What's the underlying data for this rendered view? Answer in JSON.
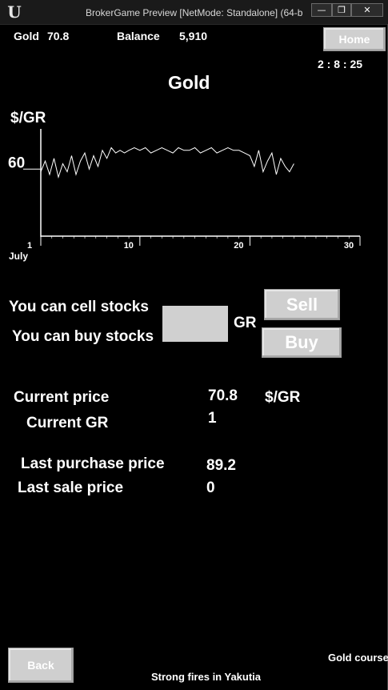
{
  "window": {
    "title": "BrokerGame Preview [NetMode: Standalone]  (64-b",
    "logo": "U",
    "minimize": "—",
    "maximize": "❐",
    "close": "✕"
  },
  "header": {
    "commodity_label": "Gold",
    "commodity_value": "70.8",
    "balance_label": "Balance",
    "balance_value": "5,910",
    "home_button": "Home",
    "timer": "2 : 8 : 25"
  },
  "chart_title": "Gold",
  "chart_data": {
    "type": "line",
    "title": "Gold",
    "ylabel": "$/GR",
    "xlabel": "July",
    "y_tick_labels": [
      "60"
    ],
    "y_tick_values": [
      60
    ],
    "x_tick_labels": [
      "1",
      "10",
      "20",
      "30"
    ],
    "x_tick_values": [
      1,
      10,
      20,
      30
    ],
    "xlim": [
      1,
      30
    ],
    "ylim": [
      35,
      75
    ],
    "grid": false,
    "series": [
      {
        "values_x": [
          1,
          1.4,
          1.8,
          2.2,
          2.6,
          3,
          3.4,
          3.8,
          4.2,
          4.6,
          5,
          5.4,
          5.8,
          6.2,
          6.6,
          7,
          7.4,
          7.8,
          8.2,
          8.6,
          9,
          9.5,
          10,
          10.5,
          11,
          11.5,
          12,
          12.5,
          13,
          13.5,
          14,
          14.5,
          15,
          15.5,
          16,
          16.5,
          17,
          17.5,
          18,
          18.5,
          19,
          19.5,
          20,
          20.4,
          20.8,
          21.2,
          21.6,
          22,
          22.4,
          22.8,
          23.2,
          23.6,
          24
        ],
        "values_y": [
          59,
          63,
          58,
          64,
          57,
          62,
          59,
          65,
          58,
          63,
          66,
          60,
          65,
          61,
          67,
          64,
          68,
          66,
          67,
          66,
          67,
          68,
          67,
          68,
          66,
          67,
          68,
          67,
          66,
          68,
          67,
          67,
          68,
          66,
          67,
          68,
          66,
          67,
          68,
          67,
          67,
          66,
          65,
          61,
          67,
          59,
          63,
          66,
          58,
          64,
          61,
          59,
          62
        ]
      }
    ]
  },
  "trade": {
    "sell_prompt": "You can cell stocks",
    "buy_prompt": "You can buy stocks",
    "amount_value": "",
    "unit": "GR",
    "sell_button": "Sell",
    "buy_button": "Buy"
  },
  "stats": {
    "current_price_label": "Current price",
    "current_price_value": "70.8",
    "current_price_unit": "$/GR",
    "current_gr_label": "Current GR",
    "current_gr_value": "1",
    "last_purchase_label": "Last purchase price",
    "last_purchase_value": "89.2",
    "last_sale_label": "Last sale price",
    "last_sale_value": "0"
  },
  "footer": {
    "back_button": "Back",
    "news_ticker": "Strong fires in Yakutia",
    "course_label": "Gold course"
  }
}
